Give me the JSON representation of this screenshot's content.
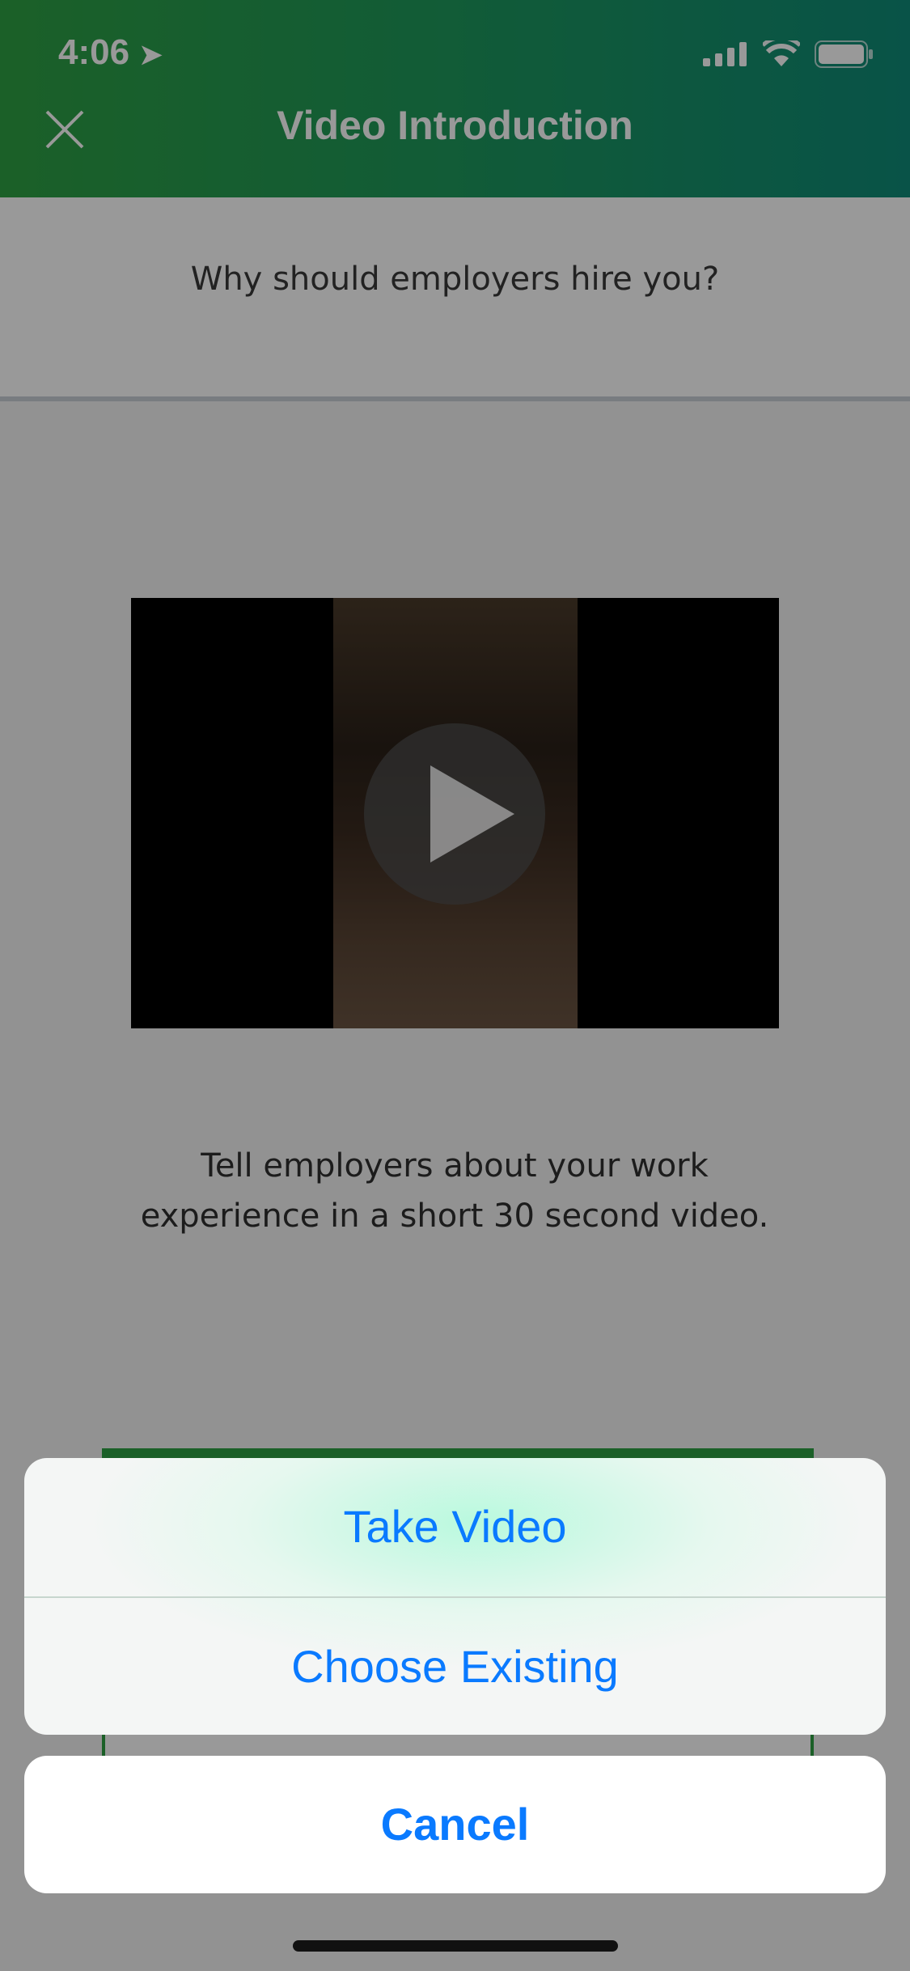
{
  "status_bar": {
    "time": "4:06"
  },
  "header": {
    "title": "Video Introduction"
  },
  "question": "Why should employers hire you?",
  "description": {
    "line1": "Tell employers about your work",
    "line2": "experience in a short 30 second video."
  },
  "action_sheet": {
    "take_video": "Take Video",
    "choose_existing": "Choose Existing",
    "cancel": "Cancel"
  },
  "colors": {
    "header_start": "#2ea043",
    "header_end": "#0f8b78",
    "accent_blue": "#0a7aff"
  }
}
